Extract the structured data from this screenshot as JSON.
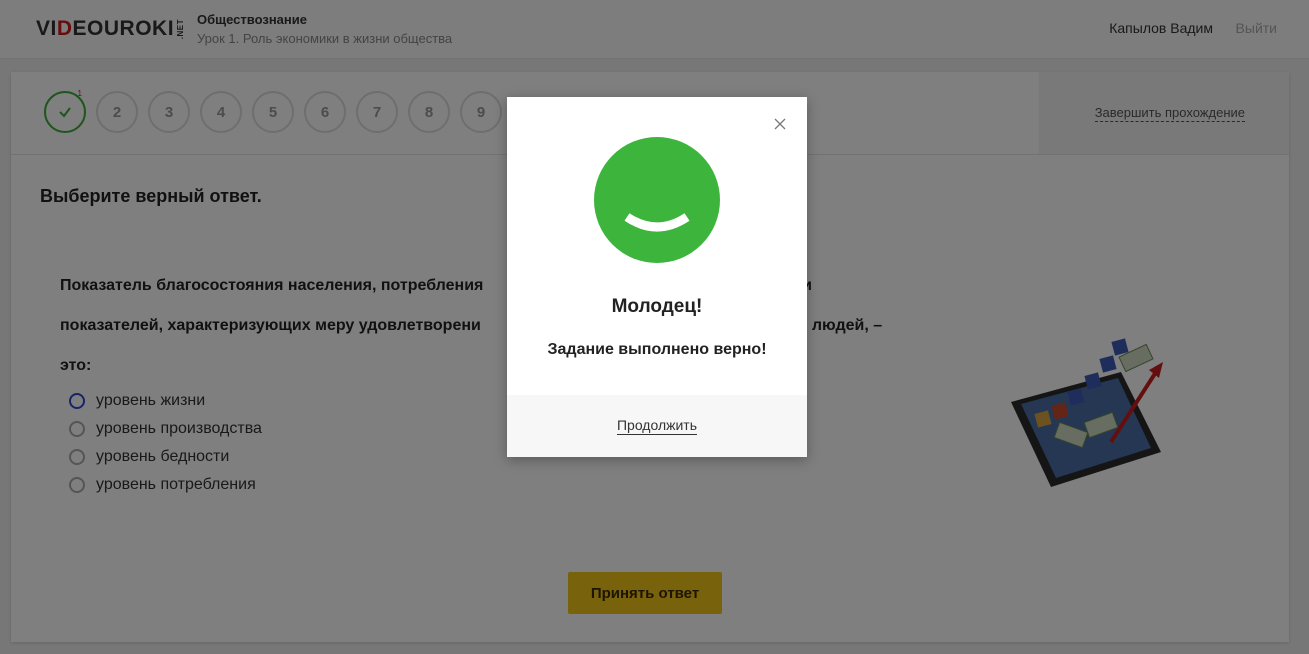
{
  "header": {
    "logo_main": "VIDEOUROKI",
    "logo_suffix": ".NET",
    "subject": "Обществознание",
    "lesson": "Урок 1. Роль экономики в жизни общества",
    "user_name": "Капылов Вадим",
    "logout_label": "Выйти"
  },
  "steps": {
    "current": {
      "badge": "1",
      "icon": "check-icon",
      "status": "done"
    },
    "items": [
      "2",
      "3",
      "4",
      "5",
      "6",
      "7",
      "8",
      "9"
    ],
    "finish_label": "Завершить прохождение"
  },
  "task": {
    "instruction": "Выберите верный ответ.",
    "question": "Показатель благосостояния населения, потребления [hidden behind dialog]й и показателей, характеризующих меру удовлетворени [hidden behind dialog]тей людей, – это:",
    "options": [
      {
        "label": "уровень жизни",
        "selected": true
      },
      {
        "label": "уровень производства",
        "selected": false
      },
      {
        "label": "уровень бедности",
        "selected": false
      },
      {
        "label": "уровень потребления",
        "selected": false
      }
    ],
    "accept_label": "Принять ответ",
    "illustration_icon": "tablet-money-chart-icon"
  },
  "modal": {
    "icon": "smiley-icon",
    "title": "Молодец!",
    "message": "Задание выполнено верно!",
    "continue_label": "Продолжить",
    "close_icon": "close-icon"
  },
  "colors": {
    "success": "#3db53d",
    "accent_button": "#f0c419",
    "radio_selected": "#2a4bd1",
    "logo_red": "#d11b1b"
  }
}
